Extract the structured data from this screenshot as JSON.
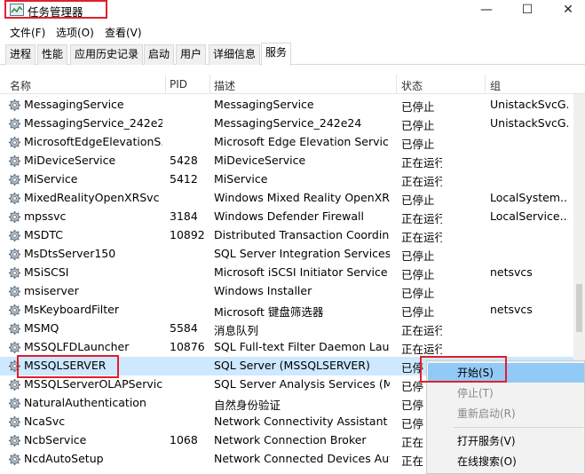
{
  "window": {
    "title": "任务管理器",
    "minimize": "—",
    "maximize": "☐",
    "close": "✕"
  },
  "menu": [
    "文件(F)",
    "选项(O)",
    "查看(V)"
  ],
  "tabs": [
    "进程",
    "性能",
    "应用历史记录",
    "启动",
    "用户",
    "详细信息",
    "服务"
  ],
  "active_tab": "服务",
  "columns": {
    "name": "名称",
    "pid": "PID",
    "desc": "描述",
    "status": "状态",
    "group": "组"
  },
  "rows": [
    {
      "name": "MessagingService",
      "pid": "",
      "desc": "MessagingService",
      "status": "已停止",
      "group": "UnistackSvcG..."
    },
    {
      "name": "MessagingService_242e24",
      "pid": "",
      "desc": "MessagingService_242e24",
      "status": "已停止",
      "group": "UnistackSvcG..."
    },
    {
      "name": "MicrosoftEdgeElevationS...",
      "pid": "",
      "desc": "Microsoft Edge Elevation Servic...",
      "status": "已停止",
      "group": ""
    },
    {
      "name": "MiDeviceService",
      "pid": "5428",
      "desc": "MiDeviceService",
      "status": "正在运行",
      "group": ""
    },
    {
      "name": "MiService",
      "pid": "5412",
      "desc": "MiService",
      "status": "正在运行",
      "group": ""
    },
    {
      "name": "MixedRealityOpenXRSvc",
      "pid": "",
      "desc": "Windows Mixed Reality OpenXR...",
      "status": "已停止",
      "group": "LocalSystem..."
    },
    {
      "name": "mpssvc",
      "pid": "3184",
      "desc": "Windows Defender Firewall",
      "status": "正在运行",
      "group": "LocalService..."
    },
    {
      "name": "MSDTC",
      "pid": "10892",
      "desc": "Distributed Transaction Coordin...",
      "status": "正在运行",
      "group": ""
    },
    {
      "name": "MsDtsServer150",
      "pid": "",
      "desc": "SQL Server Integration Services ...",
      "status": "已停止",
      "group": ""
    },
    {
      "name": "MSiSCSI",
      "pid": "",
      "desc": "Microsoft iSCSI Initiator Service",
      "status": "已停止",
      "group": "netsvcs"
    },
    {
      "name": "msiserver",
      "pid": "",
      "desc": "Windows Installer",
      "status": "已停止",
      "group": ""
    },
    {
      "name": "MsKeyboardFilter",
      "pid": "",
      "desc": "Microsoft 键盘筛选器",
      "status": "已停止",
      "group": "netsvcs"
    },
    {
      "name": "MSMQ",
      "pid": "5584",
      "desc": "消息队列",
      "status": "正在运行",
      "group": ""
    },
    {
      "name": "MSSQLFDLauncher",
      "pid": "10876",
      "desc": "SQL Full-text Filter Daemon Laun...",
      "status": "正在运行",
      "group": ""
    },
    {
      "name": "MSSQLSERVER",
      "pid": "",
      "desc": "SQL Server (MSSQLSERVER)",
      "status": "已停",
      "group": ""
    },
    {
      "name": "MSSQLServerOLAPService",
      "pid": "",
      "desc": "SQL Server Analysis Services (M...",
      "status": "已停",
      "group": ""
    },
    {
      "name": "NaturalAuthentication",
      "pid": "",
      "desc": "自然身份验证",
      "status": "已停",
      "group": ""
    },
    {
      "name": "NcaSvc",
      "pid": "",
      "desc": "Network Connectivity Assistant",
      "status": "已停",
      "group": ""
    },
    {
      "name": "NcbService",
      "pid": "1068",
      "desc": "Network Connection Broker",
      "status": "正在",
      "group": ""
    },
    {
      "name": "NcdAutoSetup",
      "pid": "",
      "desc": "Network Connected Devices Aut...",
      "status": "正在",
      "group": ""
    }
  ],
  "selected_row": "MSSQLSERVER",
  "context_menu": [
    {
      "label": "开始(S)",
      "state": "hover"
    },
    {
      "label": "停止(T)",
      "state": "disabled"
    },
    {
      "label": "重新启动(R)",
      "state": "disabled"
    },
    {
      "separator": true
    },
    {
      "label": "打开服务(V)",
      "state": "normal"
    },
    {
      "label": "在线搜索(O)",
      "state": "normal"
    }
  ],
  "colors": {
    "selection": "#cde8ff",
    "menu_hover": "#91c9f7",
    "annotation": "#e0202a"
  }
}
